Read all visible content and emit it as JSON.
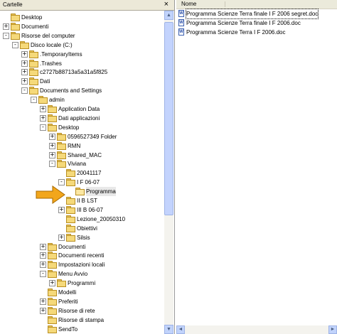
{
  "left_pane": {
    "title": "Cartelle",
    "close_glyph": "×"
  },
  "tree": [
    {
      "label": "Desktop",
      "icon": "desktop-icon",
      "expander": "",
      "indent": 0
    },
    {
      "label": "Documenti",
      "icon": "my-documents-icon",
      "expander": "+",
      "indent": 0
    },
    {
      "label": "Risorse del computer",
      "icon": "my-computer-icon",
      "expander": "-",
      "indent": 0
    },
    {
      "label": "Disco locale (C:)",
      "icon": "local-disk-icon",
      "expander": "-",
      "indent": 1
    },
    {
      "label": ".TemporaryItems",
      "icon": "folder-icon",
      "expander": "+",
      "indent": 2
    },
    {
      "label": ".Trashes",
      "icon": "folder-icon",
      "expander": "+",
      "indent": 2
    },
    {
      "label": "c2727b88713a5a31a5f825",
      "icon": "folder-icon",
      "expander": "+",
      "indent": 2
    },
    {
      "label": "Dati",
      "icon": "folder-icon",
      "expander": "+",
      "indent": 2
    },
    {
      "label": "Documents and Settings",
      "icon": "folder-icon",
      "expander": "-",
      "indent": 2
    },
    {
      "label": "admin",
      "icon": "folder-icon",
      "expander": "-",
      "indent": 3
    },
    {
      "label": "Application Data",
      "icon": "folder-icon",
      "expander": "+",
      "indent": 4
    },
    {
      "label": "Dati applicazioni",
      "icon": "folder-icon",
      "expander": "+",
      "indent": 4
    },
    {
      "label": "Desktop",
      "icon": "folder-icon",
      "expander": "-",
      "indent": 4
    },
    {
      "label": "0596527349 Folder",
      "icon": "folder-icon",
      "expander": "+",
      "indent": 5
    },
    {
      "label": "RMN",
      "icon": "folder-icon",
      "expander": "+",
      "indent": 5
    },
    {
      "label": "Shared_MAC",
      "icon": "shared-folder-icon",
      "expander": "+",
      "indent": 5
    },
    {
      "label": "Viviana",
      "icon": "folder-icon",
      "expander": "-",
      "indent": 5
    },
    {
      "label": "20041117",
      "icon": "folder-icon",
      "expander": "",
      "indent": 6
    },
    {
      "label": "I F 06-07",
      "icon": "folder-icon",
      "expander": "-",
      "indent": 6
    },
    {
      "label": "Programma",
      "icon": "open-folder-icon",
      "expander": "",
      "indent": 7,
      "selected": true
    },
    {
      "label": "II B LST",
      "icon": "folder-icon",
      "expander": "",
      "indent": 6
    },
    {
      "label": "III B 06-07",
      "icon": "folder-icon",
      "expander": "+",
      "indent": 6
    },
    {
      "label": "Lezione_20050310",
      "icon": "folder-icon",
      "expander": "",
      "indent": 6
    },
    {
      "label": "Obiettivi",
      "icon": "folder-icon",
      "expander": "",
      "indent": 6
    },
    {
      "label": "Silsis",
      "icon": "folder-icon",
      "expander": "+",
      "indent": 6
    },
    {
      "label": "Documenti",
      "icon": "folder-icon",
      "expander": "+",
      "indent": 4
    },
    {
      "label": "Documenti recenti",
      "icon": "recent-docs-icon",
      "expander": "+",
      "indent": 4
    },
    {
      "label": "Impostazioni locali",
      "icon": "folder-icon",
      "expander": "+",
      "indent": 4
    },
    {
      "label": "Menu Avvio",
      "icon": "folder-icon",
      "expander": "-",
      "indent": 4
    },
    {
      "label": "Programmi",
      "icon": "programs-icon",
      "expander": "+",
      "indent": 5
    },
    {
      "label": "Modelli",
      "icon": "folder-icon",
      "expander": "",
      "indent": 4
    },
    {
      "label": "Preferiti",
      "icon": "favorites-icon",
      "expander": "+",
      "indent": 4
    },
    {
      "label": "Risorse di rete",
      "icon": "folder-icon",
      "expander": "+",
      "indent": 4
    },
    {
      "label": "Risorse di stampa",
      "icon": "folder-icon",
      "expander": "",
      "indent": 4
    },
    {
      "label": "SendTo",
      "icon": "folder-icon",
      "expander": "",
      "indent": 4
    }
  ],
  "right_pane": {
    "column_name": "Nome",
    "files": [
      {
        "label": "Programma Scienze Terra finale I F 2006 segret.doc",
        "focused": true
      },
      {
        "label": "Programma Scienze Terra finale I F 2006.doc",
        "focused": false
      },
      {
        "label": "Programma Scienze Terra I F 2006.doc",
        "focused": false
      }
    ]
  },
  "colors": {
    "arrow_fill": "#f2a61c",
    "arrow_stroke": "#a86a00",
    "folder": "#f5d97a",
    "scroll": "#c1d3fb"
  }
}
